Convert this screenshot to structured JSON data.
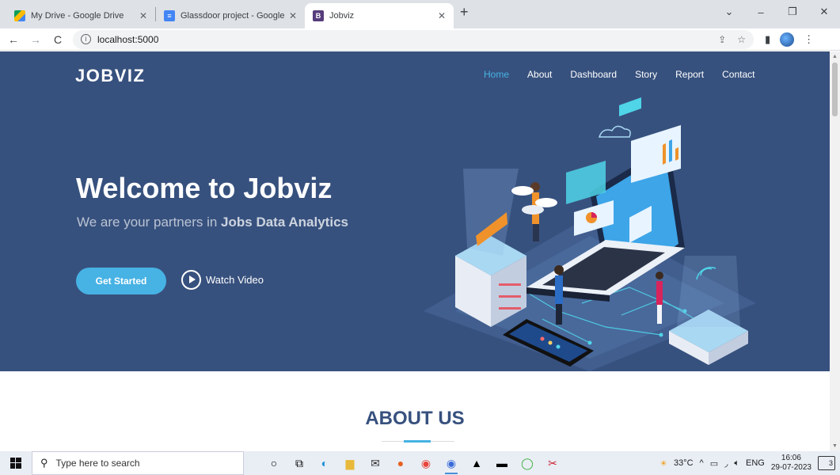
{
  "browser": {
    "tabs": [
      {
        "title": "My Drive - Google Drive",
        "favicon": "google-drive-icon",
        "active": false
      },
      {
        "title": "Glassdoor project - Google Docs",
        "favicon": "google-docs-icon",
        "active": false
      },
      {
        "title": "Jobviz",
        "favicon": "bootstrap-icon",
        "active": true
      }
    ],
    "url": "localhost:5000"
  },
  "site": {
    "logo": "JOBVIZ",
    "nav": [
      "Home",
      "About",
      "Dashboard",
      "Story",
      "Report",
      "Contact"
    ],
    "active_nav": "Home",
    "hero": {
      "title": "Welcome to Jobviz",
      "subtitle_prefix": "We are your partners in ",
      "subtitle_bold": "Jobs Data Analytics",
      "cta": "Get Started",
      "video": "Watch Video"
    },
    "about_title": "ABOUT US",
    "colors": {
      "hero_bg": "#37517e",
      "accent": "#47b2e4"
    }
  },
  "taskbar": {
    "search_placeholder": "Type here to search",
    "weather": "33°C",
    "language": "ENG",
    "time": "16:06",
    "date": "29-07-2023",
    "notifications": "3"
  }
}
